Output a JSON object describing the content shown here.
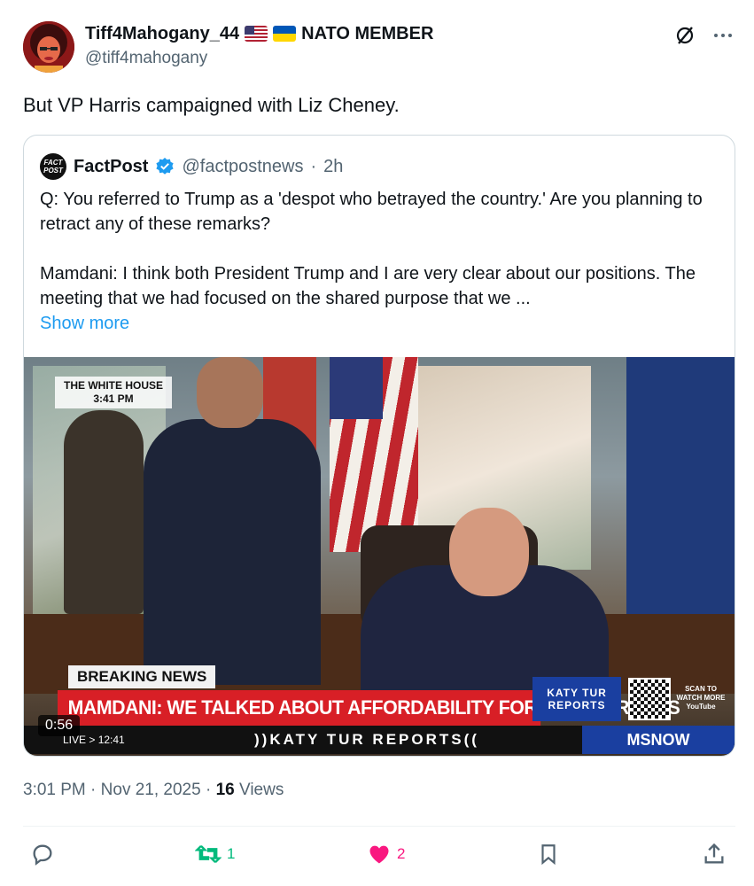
{
  "author": {
    "display_name": "Tiff4Mahogany_44",
    "flags": [
      "us-flag-icon",
      "ukraine-flag-icon"
    ],
    "member_label": "NATO MEMBER",
    "handle": "@tiff4mahogany"
  },
  "post": {
    "text": "But VP Harris campaigned with Liz Cheney."
  },
  "quote": {
    "name": "FactPost",
    "logo_text": "FACT POST",
    "handle": "@factpostnews",
    "separator": "·",
    "time": "2h",
    "paragraph1": "Q: You referred to Trump as a 'despot who betrayed the country.' Are you planning to retract any of these remarks?",
    "paragraph2": "Mamdani: I think both President Trump and I are very clear about our positions. The meeting that we had focused on the shared purpose that we ...",
    "show_more": "Show more"
  },
  "video": {
    "location_badge_line1": "THE WHITE HOUSE",
    "location_badge_line2": "3:41 PM",
    "breaking_label": "BREAKING NEWS",
    "headline": "MAMDANI: WE TALKED ABOUT AFFORDABILITY FOR NEW YORKERS",
    "show_line1": "KATY TUR",
    "show_line2": "REPORTS",
    "scan_text": "SCAN TO WATCH MORE",
    "scan_sub": "YouTube",
    "live_text": "LIVE > 12:41",
    "ticker_text": "))KATY TUR REPORTS((",
    "network": "MSNOW",
    "duration": "0:56"
  },
  "meta": {
    "time": "3:01 PM",
    "date": "Nov 21, 2025",
    "sep": "·",
    "views_count": "16",
    "views_label": "Views"
  },
  "actions": {
    "reply_count": "",
    "repost_count": "1",
    "like_count": "2"
  },
  "colors": {
    "accent": "#1d9bf0",
    "repost": "#00ba7c",
    "like": "#f91880",
    "muted": "#536471",
    "breaking_red": "#d81f26",
    "network_blue": "#1a3fa0"
  }
}
